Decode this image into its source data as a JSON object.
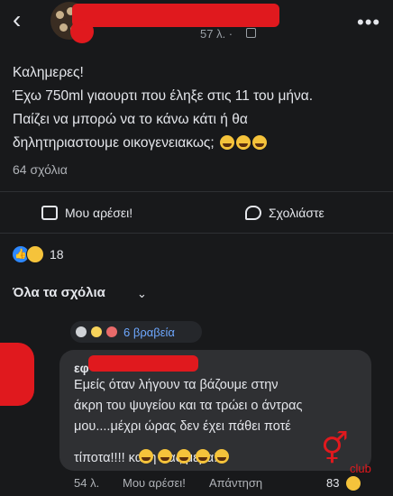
{
  "header": {
    "back_icon": "chevron-left-icon",
    "timestamp": "57 λ. ·",
    "more_icon": "more-horizontal-icon"
  },
  "post": {
    "lines": [
      "Καλημερες!",
      "Έχω 750ml γιαουρτι που έληξε στις 11 του μήνα.",
      "Παίζει να μπορώ να το κάνω κάτι ή θα",
      "δηλητηριαστουμε οικογενειακως;"
    ],
    "comments_count": "64 σχόλια"
  },
  "actions": {
    "like_label": "Μου αρέσει!",
    "comment_label": "Σχολιάστε"
  },
  "reactions": {
    "count": "18"
  },
  "comments_section": {
    "filter_label": "Όλα τα σχόλια",
    "badges_label": "6 βραβεία",
    "comment": {
      "author_visible": "εφ",
      "lines": [
        "Εμείς όταν λήγουν τα βάζουμε στην",
        "άκρη του ψυγείου και τα τρώει ο άντρας",
        "μου....μέχρι ώρας δεν έχει πάθει ποτέ",
        "τίποτα!!!! καλη σας μερα!"
      ],
      "time": "54 λ.",
      "like_label": "Μου αρέσει!",
      "reply_label": "Απάντηση",
      "reaction_count": "83"
    }
  },
  "watermark": {
    "text": "club"
  },
  "colors": {
    "background": "#18191b",
    "bubble": "#2f3033",
    "link_blue": "#6ea8ff",
    "like_blue": "#2d88ff",
    "redaction_red": "#e0191e"
  }
}
